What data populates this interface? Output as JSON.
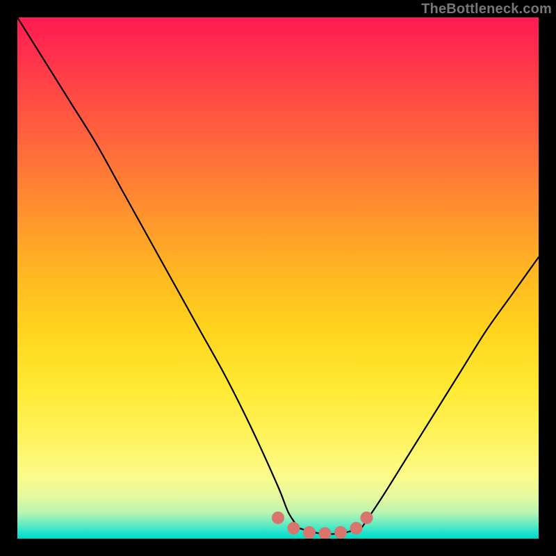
{
  "watermark": "TheBottleneck.com",
  "colors": {
    "page_bg": "#000000",
    "gradient_top": "#ff1a53",
    "gradient_mid": "#ffd41e",
    "gradient_bottom": "#00dcc0",
    "curve_color": "#000000",
    "marker_color": "#d8756d"
  },
  "chart_data": {
    "type": "line",
    "title": "",
    "xlabel": "",
    "ylabel": "",
    "xlim": [
      0,
      100
    ],
    "ylim": [
      0,
      100
    ],
    "grid": false,
    "legend": false,
    "annotations": [],
    "series": [
      {
        "name": "left-curve",
        "x": [
          0,
          5,
          10,
          15,
          20,
          25,
          30,
          35,
          40,
          45,
          50,
          52,
          54
        ],
        "y": [
          100,
          92,
          84,
          76,
          67,
          58,
          49,
          40,
          31,
          21,
          10,
          5,
          2
        ]
      },
      {
        "name": "right-curve",
        "x": [
          66,
          70,
          75,
          80,
          85,
          90,
          95,
          100
        ],
        "y": [
          2,
          8,
          16,
          24,
          32,
          40,
          47,
          54
        ]
      },
      {
        "name": "flat-bottom",
        "x": [
          54,
          58,
          62,
          66
        ],
        "y": [
          2,
          1,
          1,
          2
        ]
      }
    ],
    "markers": {
      "name": "highlighted-points",
      "color": "#d8756d",
      "points": [
        {
          "x": 50,
          "y": 4
        },
        {
          "x": 53,
          "y": 2
        },
        {
          "x": 56,
          "y": 1.2
        },
        {
          "x": 59,
          "y": 1
        },
        {
          "x": 62,
          "y": 1.2
        },
        {
          "x": 65,
          "y": 2
        },
        {
          "x": 67,
          "y": 4
        }
      ]
    }
  }
}
